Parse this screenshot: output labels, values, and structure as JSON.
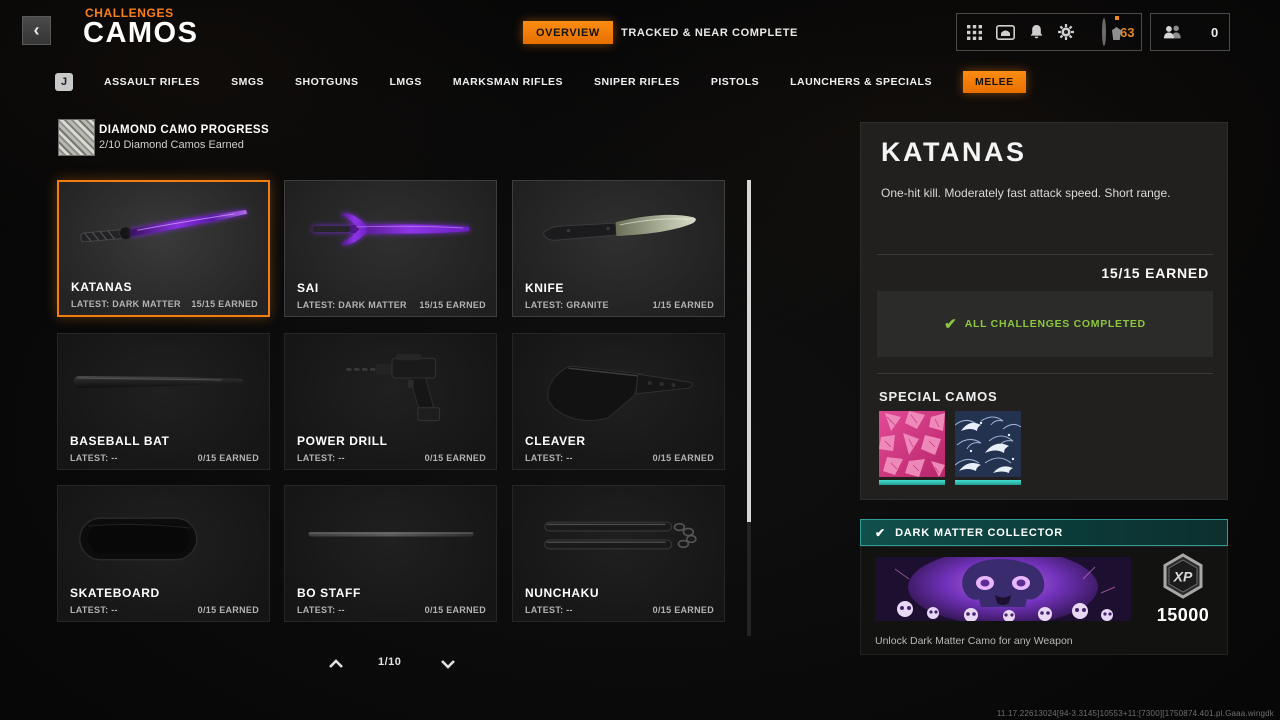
{
  "header": {
    "back_icon": "‹",
    "eyebrow": "CHALLENGES",
    "title": "CAMOS",
    "tabs": [
      {
        "label": "OVERVIEW",
        "active": true
      },
      {
        "label": "TRACKED & NEAR COMPLETE",
        "active": false
      }
    ],
    "player": {
      "level": "63",
      "social_count": "0"
    }
  },
  "class_tabs": {
    "key_hint": "J",
    "items": [
      {
        "label": "ASSAULT RIFLES",
        "active": false
      },
      {
        "label": "SMGS",
        "active": false
      },
      {
        "label": "SHOTGUNS",
        "active": false
      },
      {
        "label": "LMGS",
        "active": false
      },
      {
        "label": "MARKSMAN RIFLES",
        "active": false
      },
      {
        "label": "SNIPER RIFLES",
        "active": false
      },
      {
        "label": "PISTOLS",
        "active": false
      },
      {
        "label": "LAUNCHERS & SPECIALS",
        "active": false
      },
      {
        "label": "MELEE",
        "active": true
      }
    ]
  },
  "diamond_progress": {
    "title": "DIAMOND CAMO PROGRESS",
    "subtitle": "2/10 Diamond Camos Earned"
  },
  "cards": [
    {
      "name": "KATANAS",
      "latest": "LATEST: DARK MATTER",
      "earned": "15/15 EARNED",
      "selected": true
    },
    {
      "name": "SAI",
      "latest": "LATEST: DARK MATTER",
      "earned": "15/15 EARNED",
      "selected": false
    },
    {
      "name": "KNIFE",
      "latest": "LATEST: GRANITE",
      "earned": "1/15 EARNED",
      "selected": false
    },
    {
      "name": "BASEBALL BAT",
      "latest": "LATEST: --",
      "earned": "0/15 EARNED",
      "selected": false
    },
    {
      "name": "POWER DRILL",
      "latest": "LATEST: --",
      "earned": "0/15 EARNED",
      "selected": false
    },
    {
      "name": "CLEAVER",
      "latest": "LATEST: --",
      "earned": "0/15 EARNED",
      "selected": false
    },
    {
      "name": "SKATEBOARD",
      "latest": "LATEST: --",
      "earned": "0/15 EARNED",
      "selected": false
    },
    {
      "name": "BO STAFF",
      "latest": "LATEST: --",
      "earned": "0/15 EARNED",
      "selected": false
    },
    {
      "name": "NUNCHAKU",
      "latest": "LATEST: --",
      "earned": "0/15 EARNED",
      "selected": false
    }
  ],
  "pagination": {
    "current": "1/10"
  },
  "detail_panel": {
    "title": "KATANAS",
    "description": "One-hit kill. Moderately fast attack speed. Short range.",
    "earned": "15/15 EARNED",
    "completed_check": "✔",
    "completed_label": "ALL CHALLENGES COMPLETED",
    "special_camos_title": "SPECIAL CAMOS",
    "special_camos": [
      "pink-petal-camo",
      "blue-wave-camo"
    ]
  },
  "collector": {
    "check": "✔",
    "title": "DARK MATTER COLLECTOR",
    "reward_icon": "XP",
    "reward_value": "15000",
    "description": "Unlock Dark Matter Camo for any Weapon"
  },
  "footer": {
    "version": "11.17.22613024[94-3.3145]10553+11:[7300][1750874.401.pl.Gaaa.wingdk"
  },
  "colors": {
    "accent_orange": "#f07e12",
    "teal": "#2d9d95",
    "success_green": "#8dc63f",
    "level_orange": "#e08a28",
    "panel_bg": "#21201e"
  }
}
